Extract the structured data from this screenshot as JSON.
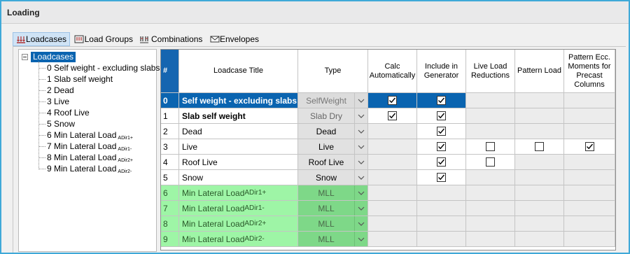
{
  "window": {
    "title": "Loading"
  },
  "tabs": [
    {
      "label": "Loadcases",
      "icon": "loadcases-icon",
      "active": true
    },
    {
      "label": "Load Groups",
      "icon": "load-groups-icon",
      "active": false
    },
    {
      "label": "Combinations",
      "icon": "combinations-icon",
      "active": false
    },
    {
      "label": "Envelopes",
      "icon": "envelopes-icon",
      "active": false
    }
  ],
  "tree": {
    "root": "Loadcases",
    "items": [
      {
        "label": "0 Self weight - excluding slabs",
        "sub": ""
      },
      {
        "label": "1 Slab self weight",
        "sub": ""
      },
      {
        "label": "2 Dead",
        "sub": ""
      },
      {
        "label": "3 Live",
        "sub": ""
      },
      {
        "label": "4 Roof Live",
        "sub": ""
      },
      {
        "label": "5 Snow",
        "sub": ""
      },
      {
        "label": "6 Min Lateral Load",
        "sub": "ADir1+"
      },
      {
        "label": "7 Min Lateral Load",
        "sub": "ADir1-"
      },
      {
        "label": "8 Min Lateral Load",
        "sub": "ADir2+"
      },
      {
        "label": "9 Min Lateral Load",
        "sub": "ADir2-"
      }
    ]
  },
  "grid": {
    "headers": {
      "index": "#",
      "title": "Loadcase Title",
      "type": "Type",
      "calc": "Calc Automatically",
      "generator": "Include in Generator",
      "live_red": "Live Load Reductions",
      "pattern": "Pattern Load",
      "pattern_ecc": "Pattern Ecc. Moments for Precast Columns"
    },
    "rows": [
      {
        "index": "0",
        "title": "Self weight - excluding slabs",
        "sub": "",
        "type": "SelfWeight",
        "style": "sel",
        "calc": "checked",
        "gen": "checked",
        "live": "none",
        "pattern": "none",
        "ecc": "none"
      },
      {
        "index": "1",
        "title": "Slab self weight",
        "sub": "",
        "type": "Slab Dry",
        "style": "bold grey",
        "calc": "checked",
        "gen": "checked",
        "live": "none",
        "pattern": "none",
        "ecc": "none"
      },
      {
        "index": "2",
        "title": "Dead",
        "sub": "",
        "type": "Dead",
        "style": "",
        "calc": "none",
        "gen": "checked",
        "live": "none",
        "pattern": "none",
        "ecc": "none"
      },
      {
        "index": "3",
        "title": "Live",
        "sub": "",
        "type": "Live",
        "style": "",
        "calc": "none",
        "gen": "checked",
        "live": "unchecked",
        "pattern": "unchecked",
        "ecc": "checked"
      },
      {
        "index": "4",
        "title": "Roof Live",
        "sub": "",
        "type": "Roof Live",
        "style": "",
        "calc": "none",
        "gen": "checked",
        "live": "unchecked",
        "pattern": "none",
        "ecc": "none"
      },
      {
        "index": "5",
        "title": "Snow",
        "sub": "",
        "type": "Snow",
        "style": "",
        "calc": "none",
        "gen": "checked",
        "live": "none",
        "pattern": "none",
        "ecc": "none"
      },
      {
        "index": "6",
        "title": "Min Lateral Load",
        "sub": "ADir1+",
        "type": "MLL",
        "style": "green",
        "calc": "none",
        "gen": "none",
        "live": "none",
        "pattern": "none",
        "ecc": "none"
      },
      {
        "index": "7",
        "title": "Min Lateral Load",
        "sub": "ADir1-",
        "type": "MLL",
        "style": "green",
        "calc": "none",
        "gen": "none",
        "live": "none",
        "pattern": "none",
        "ecc": "none"
      },
      {
        "index": "8",
        "title": "Min Lateral Load",
        "sub": "ADir2+",
        "type": "MLL",
        "style": "green",
        "calc": "none",
        "gen": "none",
        "live": "none",
        "pattern": "none",
        "ecc": "none"
      },
      {
        "index": "9",
        "title": "Min Lateral Load",
        "sub": "ADir2-",
        "type": "MLL",
        "style": "green",
        "calc": "none",
        "gen": "none",
        "live": "none",
        "pattern": "none",
        "ecc": "none"
      }
    ]
  },
  "colors": {
    "selection": "#0a64b0",
    "header_index": "#1565b0",
    "mll_row": "#9ef5a6",
    "mll_type": "#7ed888",
    "window_border": "#3fa9d8"
  }
}
